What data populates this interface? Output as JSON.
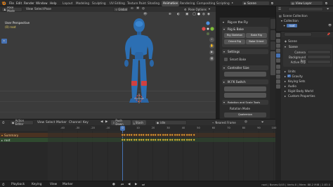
{
  "colors": {
    "accent": "#4772b3",
    "header": "#2b2b2b",
    "viewport": "#3b3b3b",
    "summary_orange": "#f0a030",
    "keyframe": "#e8c032",
    "robot_body": "#2c6fb3",
    "robot_accent": "#d04040",
    "gravity_blue": "#4772b3"
  },
  "topbar": {
    "menus": [
      "File",
      "Edit",
      "Render",
      "Window",
      "Help"
    ],
    "tabs": [
      "Layout",
      "Modeling",
      "Sculpting",
      "UV Editing",
      "Texture Paint",
      "Shading",
      "Animation",
      "Rendering",
      "Compositing",
      "Scripting"
    ],
    "active_tab": "Animation",
    "scene_label": "Scene",
    "view_layer_label": "View Layer"
  },
  "viewport": {
    "mode": "Pose Mode",
    "menus": [
      "View",
      "Select",
      "Pose"
    ],
    "orientation": "Global",
    "pose_options": "Pose Options",
    "overlay_title": "User Perspective",
    "overlay_subtitle": "(0) root"
  },
  "npanel": {
    "rig_title": "Rig on the Fly",
    "rig_bake": "Rig & Bake",
    "btn_rig_skeleton": "Rig Skeleton",
    "btn_bake_rig": "Bake Rig",
    "btn_orient_rig": "Orient Rig",
    "btn_bake_orient": "Bake Orient",
    "settings": "Settings",
    "smart_bake": "Smart Bake",
    "controller_size": "Controller Size",
    "ik_fk_switch": "IK FK Switch",
    "rotation_scale_tools": "Rotation and Scale Tools",
    "rotation_mode": "Rotation Mode",
    "quaternion": "Quaternion",
    "tabs": [
      "Tool",
      "View",
      "Edit",
      "Rig on the Fly"
    ]
  },
  "outliner": {
    "title": "Scene Collection",
    "items": [
      "Collection",
      "root"
    ]
  },
  "properties": {
    "header": "Scene",
    "section": "Scene",
    "rows": [
      {
        "label": "Camera",
        "value": ""
      },
      {
        "label": "Background Sce",
        "value": ""
      },
      {
        "label": "Active Clip",
        "value": ""
      }
    ],
    "panels": [
      "Units",
      "Gravity",
      "Keying Sets",
      "Audio",
      "Rigid Body World",
      "Custom Properties"
    ]
  },
  "editor": {
    "type": "Action Editor",
    "menus": [
      "View",
      "Select",
      "Marker",
      "Channel",
      "Key"
    ],
    "push_down": "Push Down",
    "stash": "Stash",
    "action_name": "idle",
    "nearest_frame": "Nearest Frame",
    "channels": [
      "Summary",
      "root"
    ],
    "ruler_ticks": [
      "-40",
      "-30",
      "-20",
      "-10",
      "0",
      "10",
      "20",
      "30",
      "40",
      "50",
      "60",
      "70",
      "80",
      "90",
      "100"
    ],
    "current_frame": "0"
  },
  "statusbar": {
    "items": [
      "Playback",
      "Keying",
      "View",
      "Marker"
    ],
    "version_info": "root | Bones:0/45 | Verts:0 | Mem: 88.2 MiB | 2.83.0"
  }
}
